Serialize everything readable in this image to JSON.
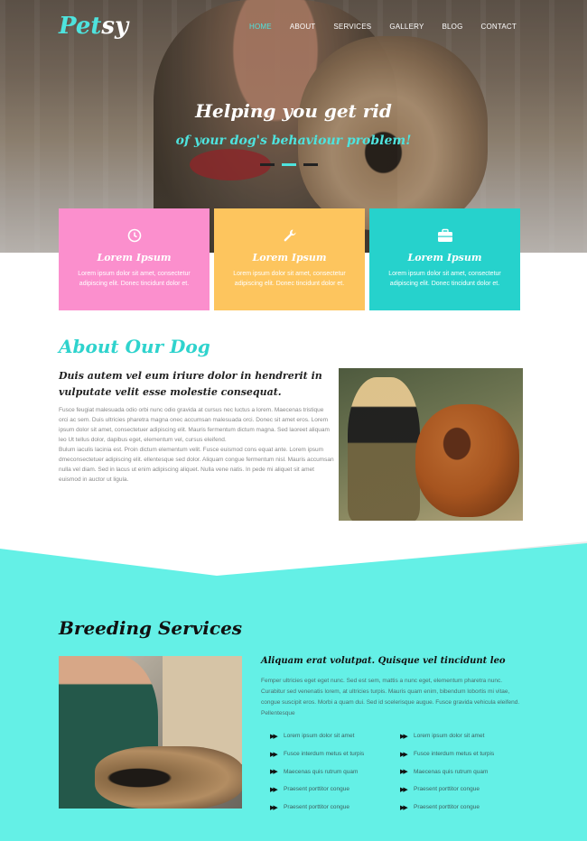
{
  "brand": {
    "logo_part1": "Pet",
    "logo_part2": "sy"
  },
  "nav": {
    "items": [
      "HOME",
      "ABOUT",
      "SERVICES",
      "GALLERY",
      "BLOG",
      "CONTACT"
    ],
    "active": "HOME"
  },
  "hero": {
    "title": "Helping you get rid",
    "subtitle": "of your dog's behaviour problem!",
    "slides": 3,
    "active_slide": 2
  },
  "features": [
    {
      "icon": "clock-icon",
      "title": "Lorem Ipsum",
      "text": "Lorem ipsum dolor sit amet, consectetur adipiscing elit. Donec tincidunt dolor et.",
      "color": "#fb8fcd"
    },
    {
      "icon": "wrench-icon",
      "title": "Lorem Ipsum",
      "text": "Lorem ipsum dolor sit amet, consectetur adipiscing elit. Donec tincidunt dolor et.",
      "color": "#fdc55e"
    },
    {
      "icon": "briefcase-icon",
      "title": "Lorem Ipsum",
      "text": "Lorem ipsum dolor sit amet, consectetur adipiscing elit. Donec tincidunt dolor et.",
      "color": "#26d2cc"
    }
  ],
  "about": {
    "title": "About Our Dog",
    "heading": "Duis autem vel eum iriure dolor in hendrerit in vulputate velit esse molestie consequat.",
    "body": "Fusce feugiat malesuada odio orbi nunc odio gravida at cursus nec luctus a lorem. Maecenas tristique orci ac sem. Duis ultricies pharetra magna onec accumsan malesuada orci. Donec sit amet eros. Lorem ipsum dolor sit amet, consectetuer adipiscing elit. Mauris fermentum dictum magna. Sed laoreet aliquam leo Ut tellus dolor, dapibus eget, elementum vel, cursus eleifend.",
    "body2": "Bulum iaculis lacinia est. Proin dictum elementum velit. Fusce euismod cons equat ante. Lorem ipsum dmeconsectetuer adipiscing elit. ellentesque sed dolor. Aliquam congue fermentum nisl. Mauris accumsan nulla vel diam. Sed in lacus ut enim adipiscing aliquet. Nulla vene natis. In pede mi aliquet sit amet euismod in auctor ut ligula."
  },
  "breeding": {
    "title": "Breeding Services",
    "heading": "Aliquam erat volutpat. Quisque vel tincidunt leo",
    "body": "Femper ultricies eget eget nunc. Sed est sem, mattis a nunc eget, elementum pharetra nunc. Curabitur sed venenatis lorem, at ultricies turpis. Mauris quam enim, bibendum lobortis mi vitae, congue suscipit eros. Morbi a quam dui. Sed id scelerisque augue. Fusce gravida vehicula eleifend. Pellentesque",
    "list_left": [
      "Lorem ipsum dolor sit amet",
      "Fusce interdum metus et turpis",
      "Maecenas quis rutrum quam",
      "Praesent porttitor congue",
      "Praesent porttitor congue"
    ],
    "list_right": [
      "Lorem ipsum dolor sit amet",
      "Fusce interdum metus et turpis",
      "Maecenas quis rutrum quam",
      "Praesent porttitor congue",
      "Praesent porttitor congue"
    ]
  },
  "colors": {
    "accent": "#4ee3de",
    "section_bg": "#64f0e6",
    "pink": "#fb8fcd",
    "yellow": "#fdc55e",
    "teal": "#26d2cc"
  }
}
